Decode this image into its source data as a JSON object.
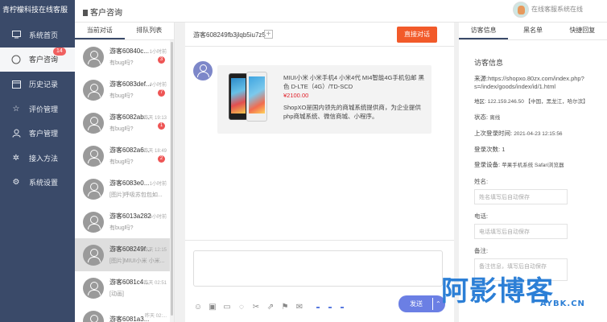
{
  "app": {
    "brand": "青柠檬科技在线客服",
    "header_title": "客户咨询",
    "online_status": "在线客服系统在线"
  },
  "sidebar": {
    "items": [
      {
        "label": "系统首页",
        "icon": "monitor-icon",
        "active": false
      },
      {
        "label": "客户咨询",
        "icon": "chat-bubble-icon",
        "active": true,
        "badge": "14"
      },
      {
        "label": "历史记录",
        "icon": "calendar-icon",
        "active": false
      },
      {
        "label": "评价管理",
        "icon": "star-icon",
        "active": false
      },
      {
        "label": "客户管理",
        "icon": "user-icon",
        "active": false
      },
      {
        "label": "接入方法",
        "icon": "settings-gear-icon",
        "active": false
      },
      {
        "label": "系统设置",
        "icon": "gear-icon",
        "active": false
      }
    ]
  },
  "conversations": {
    "tabs": [
      "当前对话",
      "排队列表"
    ],
    "items": [
      {
        "name": "游客60840c...",
        "time": "1小时前",
        "msg": "有bug吗?",
        "count": "3"
      },
      {
        "name": "游客6083def...",
        "time": "4小时前",
        "msg": "有bug吗?",
        "count": "7"
      },
      {
        "name": "游客6082ab...",
        "time": "昨天 19:13",
        "msg": "有bug吗?",
        "count": "1"
      },
      {
        "name": "游客6082a6...",
        "time": "昨天 18:49",
        "msg": "有bug吗?",
        "count": "2"
      },
      {
        "name": "游客6083e0...",
        "time": "1小时前",
        "msg": "[图片]呼吸苏包包如...",
        "count": ""
      },
      {
        "name": "游客6013a282",
        "time": "4小时前",
        "msg": "有bug吗?",
        "count": ""
      },
      {
        "name": "游客608249f...",
        "time": "昨天 12:15",
        "msg": "[图片]MIUI小米 小米...",
        "count": ""
      },
      {
        "name": "游客6081c4...",
        "time": "昨天 02:51",
        "msg": "[动画]",
        "count": ""
      },
      {
        "name": "游客6081a3...",
        "time": "昨天 02:...",
        "msg": "",
        "count": ""
      }
    ]
  },
  "chat": {
    "title": "游客608249fb3jlqb5iu7z5",
    "end_button": "直接对话",
    "product": {
      "title": "MIUI小米 小米手机4 小米4代 MI4智能4G手机包邮 黑色 D-LTE（4G）/TD-SCD",
      "price": "¥2100.00",
      "desc": "ShopXO是国内领先的商城系统提供商，为企业提供php商城系统、微信商城、小程序。"
    },
    "send_button": "发送",
    "toolbar_icons": [
      "emoji-icon",
      "image-icon",
      "folder-icon",
      "chat-icon",
      "scissors-icon",
      "share-icon",
      "cart-icon",
      "gift-icon"
    ]
  },
  "info": {
    "tabs": [
      "访客信息",
      "黑名单",
      "快捷回复"
    ],
    "title": "访客信息",
    "source_label": "来源:",
    "source_value": "https://shopxo.80zx.com/index.php?s=/index/goods/index/id/1.html",
    "region_label": "地区:",
    "region_value": "122.159.246.50 【中国，黑龙江，哈尔滨】",
    "status_label": "状态:",
    "status_value": "离线",
    "last_login_label": "上次登录时间:",
    "last_login_value": "2021-04-23 12:15:56",
    "login_count_label": "登录次数:",
    "login_count_value": "1",
    "device_label": "登录设备:",
    "device_value": "苹果手机系统 Safari浏览器",
    "name_label": "姓名:",
    "name_placeholder": "姓名填写后自动保存",
    "phone_label": "电话:",
    "phone_placeholder": "电话填写后自动保存",
    "note_label": "备注:",
    "note_placeholder": "备注信息，填写后自动保存"
  },
  "watermark": {
    "big": "阿影博客",
    "small": "AYBK.CN"
  }
}
